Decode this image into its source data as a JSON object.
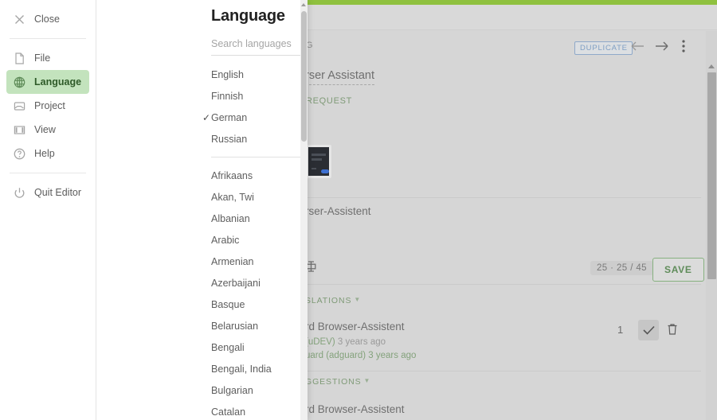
{
  "background": {
    "accent_color": "#8fc13f",
    "breadcrumb": "G",
    "duplicate_badge": "DUPLICATE",
    "source_string": "rser Assistant",
    "request_link": "REQUEST",
    "target_string": "rser-Assistent",
    "counts": "25 · 25 / 45",
    "save_label": "SAVE",
    "translations_header": "SLATIONS",
    "suggestions_header": "GGESTIONS",
    "translation_row": {
      "text": "rd Browser-Assistent",
      "author": "(uDEV)",
      "author_time": "3 years ago",
      "approver": "uard (adguard)",
      "approver_time": "3 years ago",
      "votes": "1"
    },
    "suggestion_row": {
      "text": "rd Browser-Assistent"
    }
  },
  "menu": {
    "close_label": "Close",
    "items": [
      {
        "label": "File",
        "icon": "file-icon",
        "active": false
      },
      {
        "label": "Language",
        "icon": "globe-icon",
        "active": true
      },
      {
        "label": "Project",
        "icon": "inbox-icon",
        "active": false
      },
      {
        "label": "View",
        "icon": "columns-icon",
        "active": false
      },
      {
        "label": "Help",
        "icon": "help-icon",
        "active": false
      }
    ],
    "quit_label": "Quit Editor",
    "active_color": "#c3e3bd"
  },
  "language_panel": {
    "title": "Language",
    "search_placeholder": "Search languages",
    "recent": [
      {
        "name": "English",
        "selected": false
      },
      {
        "name": "Finnish",
        "selected": false
      },
      {
        "name": "German",
        "selected": true
      },
      {
        "name": "Russian",
        "selected": false
      }
    ],
    "all": [
      {
        "name": "Afrikaans",
        "selected": false
      },
      {
        "name": "Akan, Twi",
        "selected": false
      },
      {
        "name": "Albanian",
        "selected": false
      },
      {
        "name": "Arabic",
        "selected": false
      },
      {
        "name": "Armenian",
        "selected": false
      },
      {
        "name": "Azerbaijani",
        "selected": false
      },
      {
        "name": "Basque",
        "selected": false
      },
      {
        "name": "Belarusian",
        "selected": false
      },
      {
        "name": "Bengali",
        "selected": false
      },
      {
        "name": "Bengali, India",
        "selected": false
      },
      {
        "name": "Bulgarian",
        "selected": false
      },
      {
        "name": "Catalan",
        "selected": false
      }
    ],
    "check_glyph": "✓"
  }
}
